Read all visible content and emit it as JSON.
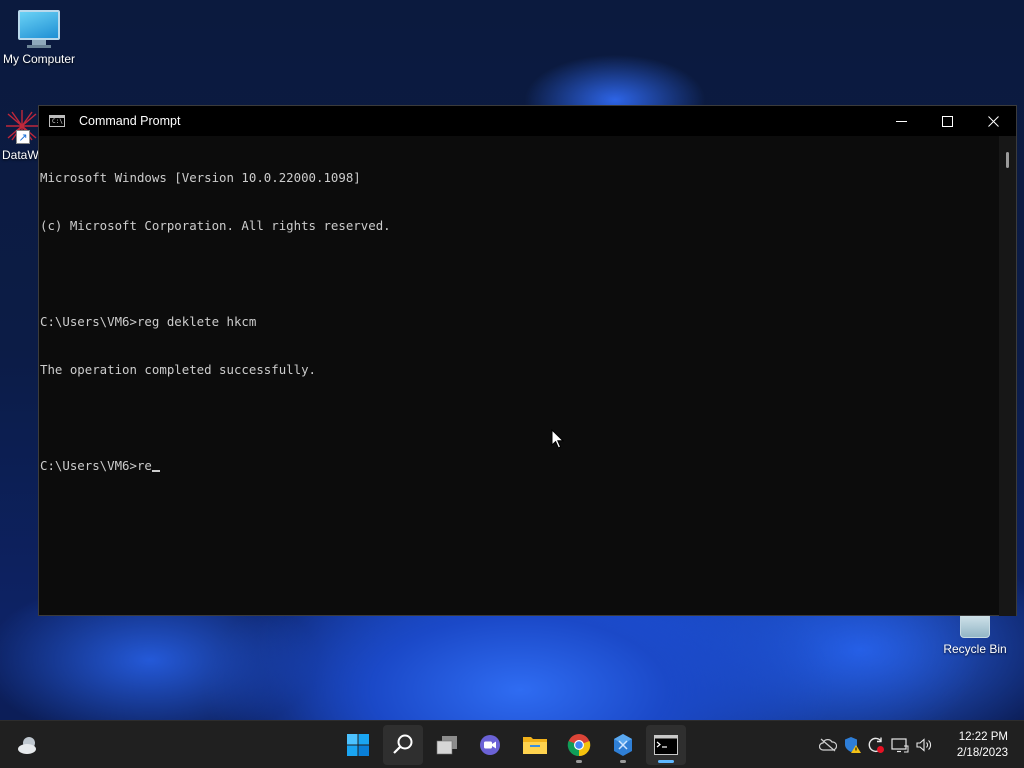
{
  "desktop": {
    "icons": [
      {
        "label": "My Computer"
      },
      {
        "label": "DataW"
      },
      {
        "label": "Recycle Bin"
      }
    ]
  },
  "window": {
    "title": "Command Prompt",
    "icon": "cmd-icon",
    "controls": [
      "minimize-icon",
      "maximize-icon",
      "close-icon"
    ]
  },
  "console": {
    "lines": [
      "Microsoft Windows [Version 10.0.22000.1098]",
      "(c) Microsoft Corporation. All rights reserved.",
      "",
      "C:\\Users\\VM6>reg deklete hkcm",
      "The operation completed successfully.",
      "",
      "C:\\Users\\VM6>re"
    ]
  },
  "taskbar": {
    "apps": [
      "windows-start-icon",
      "search-icon",
      "task-view-icon",
      "chat-icon",
      "file-explorer-icon",
      "chrome-icon",
      "app-icon",
      "terminal-icon"
    ],
    "tray": [
      "onedrive-icon",
      "security-icon",
      "sync-icon",
      "network-icon",
      "volume-icon"
    ],
    "clock": {
      "time": "12:22 PM",
      "date": "2/18/2023"
    }
  },
  "colors": {
    "console_bg": "#0c0c0c",
    "console_fg": "#cccccc",
    "taskbar_bg": "#202020",
    "accent": "#5eb7ff"
  }
}
